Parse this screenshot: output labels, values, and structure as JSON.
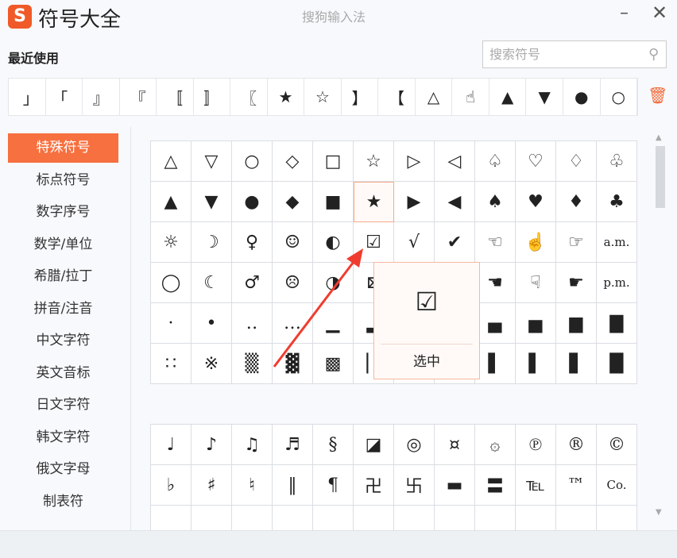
{
  "header": {
    "logo": "S",
    "title": "符号大全",
    "ime_name": "搜狗输入法",
    "minimize": "–",
    "close": "✕"
  },
  "recent": {
    "label": "最近使用",
    "items": [
      "｣",
      "｢",
      "』",
      "『",
      "〚",
      "〛",
      "〖",
      "★",
      "☆",
      "】",
      "【",
      "△",
      "☝",
      "▲",
      "▼",
      "●",
      "○"
    ],
    "clear_icon": "🗑"
  },
  "search": {
    "placeholder": "搜索符号",
    "value": "",
    "icon": "⚲"
  },
  "sidebar": {
    "active": 0,
    "items": [
      "特殊符号",
      "标点符号",
      "数字序号",
      "数学/单位",
      "希腊/拉丁",
      "拼音/注音",
      "中文字符",
      "英文音标",
      "日文字符",
      "韩文字符",
      "俄文字母",
      "制表符"
    ]
  },
  "grid1": [
    "△",
    "▽",
    "○",
    "◇",
    "□",
    "☆",
    "▷",
    "◁",
    "♤",
    "♡",
    "♢",
    "♧",
    "▲",
    "▼",
    "●",
    "◆",
    "■",
    "★",
    "▶",
    "◀",
    "♠",
    "♥",
    "♦",
    "♣",
    "☼",
    "☽",
    "♀",
    "☺",
    "◐",
    "☑",
    "√",
    "✔",
    "☜",
    "☝",
    "☞",
    "a.m.",
    "◯",
    "☾",
    "♂",
    "☹",
    "◑",
    "⊠",
    "",
    "",
    "☚",
    "☟",
    "☛",
    "p.m.",
    "·",
    "•",
    "‥",
    "…",
    "▁",
    "▂",
    "",
    "",
    "▄",
    "▅",
    "▆",
    "▇",
    "∷",
    "※",
    "▒",
    "▓",
    "▩",
    "▏",
    "",
    "",
    "▌",
    "▌",
    "▋",
    "█"
  ],
  "grid2": [
    "♩",
    "♪",
    "♫",
    "♬",
    "§",
    "◪",
    "◎",
    "¤",
    "۞",
    "℗",
    "®",
    "©",
    "♭",
    "♯",
    "♮",
    "‖",
    "¶",
    "卍",
    "卐",
    "▬",
    "〓",
    "℡",
    "™",
    "Co.",
    "",
    "",
    "",
    "",
    "",
    "",
    "",
    "",
    "",
    "",
    "",
    ""
  ],
  "selected_index": 17,
  "popup": {
    "symbol": "☑",
    "select_label": "选中"
  },
  "colors": {
    "accent": "#f7703f",
    "arrow": "#f03c2e"
  }
}
